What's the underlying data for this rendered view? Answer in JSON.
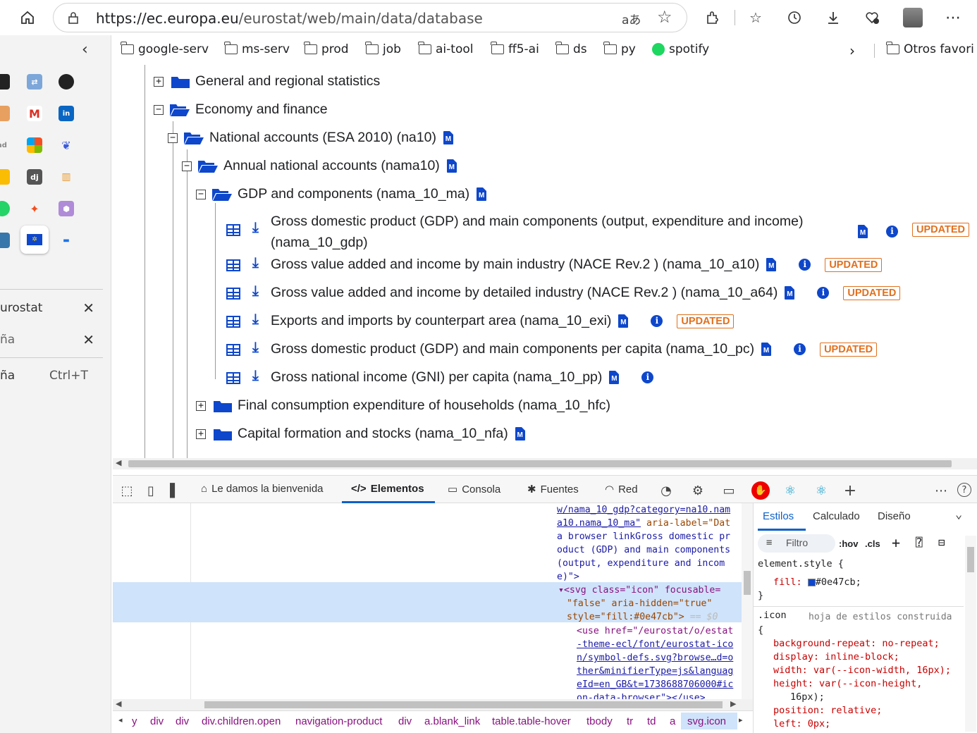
{
  "browser": {
    "url_host": "https://ec.europa.eu",
    "url_path": "/eurostat/web/main/data/database",
    "bookmarks": [
      "google-serv",
      "ms-serv",
      "prod",
      "job",
      "ai-tool",
      "ff5-ai",
      "ds",
      "py",
      "spotify"
    ],
    "other_favorites": "Otros favori"
  },
  "sidebar": {
    "tabs": [
      {
        "label": "urostat",
        "close": "✕"
      },
      {
        "label": "ña",
        "close": "✕"
      }
    ],
    "new_tab": {
      "label": "ña",
      "shortcut": "Ctrl+T"
    }
  },
  "tree": {
    "n1": "General and regional statistics",
    "n2": "Economy and finance",
    "n3": "National accounts (ESA 2010) (na10)",
    "n4": "Annual national accounts (nama10)",
    "n5": "GDP and components (nama_10_ma)",
    "ds": [
      {
        "line1": "Gross domestic product (GDP) and main components (output, expenditure and income)",
        "line2": "(nama_10_gdp)",
        "badge": "UPDATED"
      },
      {
        "line1": "Gross value added and income by main industry (NACE Rev.2 ) (nama_10_a10)",
        "badge": "UPDATED"
      },
      {
        "line1": "Gross value added and income by detailed industry (NACE Rev.2 ) (nama_10_a64)",
        "badge": "UPDATED"
      },
      {
        "line1": "Exports and imports by counterpart area (nama_10_exi)",
        "badge": "UPDATED"
      },
      {
        "line1": "Gross domestic product (GDP) and main components per capita (nama_10_pc)",
        "badge": "UPDATED"
      },
      {
        "line1": "Gross national income (GNI) per capita (nama_10_pp)"
      }
    ],
    "n6": "Final consumption expenditure of households (nama_10_hfc)",
    "n7": "Capital formation and stocks (nama_10_nfa)"
  },
  "devtools": {
    "tabs": {
      "welcome": "Le damos la bienvenida",
      "elements": "Elementos",
      "console": "Consola",
      "sources": "Fuentes",
      "network": "Red"
    },
    "dom_lines": [
      "w/nama_10_gdp?category=na10.nam",
      "a10.nama_10_ma\"",
      "aria-label=\"Dat",
      "a browser linkGross domestic pr",
      "oduct (GDP) and main components",
      "(output, expenditure and incom",
      "e)\">",
      "<svg class=\"icon\" focusable=",
      "\"false\" aria-hidden=\"true\"",
      "style=\"fill:#0e47cb\">",
      "== $0",
      "<use href=\"/eurostat/o/estat",
      "-theme-ecl/font/eurostat-ico",
      "n/symbol-defs.svg?browse…d=o",
      "ther&minifierType=js&languag",
      "eId=en_GB&t=1738688706000#ic",
      "on-data-browser\"></use>"
    ],
    "breadcrumbs": [
      "y",
      "div",
      "div",
      "div.children.open",
      "navigation-product",
      "div",
      "a.blank_link",
      "table.table-hover",
      "tbody",
      "tr",
      "td",
      "a",
      "svg.icon"
    ],
    "styles": {
      "tabs": [
        "Estilos",
        "Calculado",
        "Diseño"
      ],
      "filter_placeholder": "Filtro",
      "hov": ":hov",
      "cls": ".cls",
      "lines": [
        "element.style {",
        "fill:",
        "#0e47cb;",
        "}",
        ".icon",
        "hoja de estilos construida",
        "{",
        "background-repeat: no-repeat;",
        "display: inline-block;",
        "width: var(--icon-width, 16px);",
        "height: var(--icon-height,",
        "16px);",
        "position: relative;",
        "left: 0px;"
      ]
    }
  },
  "colors": {
    "accent": "#0e47cb",
    "badge": "#e0701e"
  }
}
